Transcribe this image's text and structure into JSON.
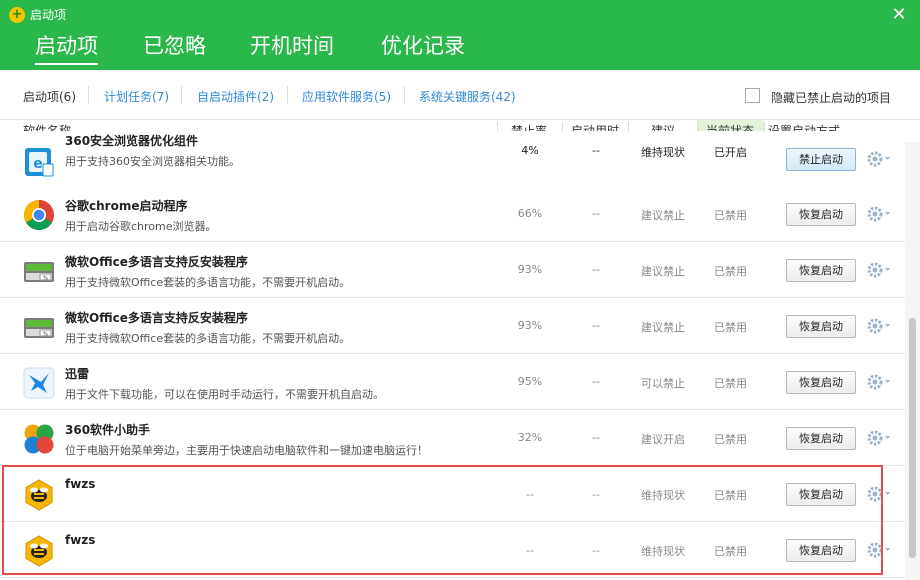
{
  "window": {
    "title": "启动项",
    "close_glyph": "✕",
    "logo_glyph": "+"
  },
  "main_tabs": [
    {
      "label": "启动项",
      "active": true
    },
    {
      "label": "已忽略"
    },
    {
      "label": "开机时间"
    },
    {
      "label": "优化记录"
    }
  ],
  "sub_tabs": [
    {
      "label": "启动项(6)",
      "active": true
    },
    {
      "label": "计划任务(7)"
    },
    {
      "label": "自启动插件(2)"
    },
    {
      "label": "应用软件服务(5)"
    },
    {
      "label": "系统关键服务(42)"
    }
  ],
  "hide_disabled": {
    "label": "隐藏已禁止启动的项目",
    "checked": false
  },
  "columns": {
    "name": "软件名称",
    "rate": "禁止率",
    "time": "启动用时",
    "suggestion": "建议",
    "status": "当前状态",
    "action": "设置启动方式"
  },
  "rows": [
    {
      "name": "360安全浏览器优化组件",
      "desc": "用于支持360安全浏览器相关功能。",
      "rate": "4%",
      "time": "--",
      "suggestion": "维持现状",
      "status": "已开启",
      "action": "禁止启动",
      "icon": "360-browser-icon"
    },
    {
      "name": "谷歌chrome启动程序",
      "desc": "用于启动谷歌chrome浏览器。",
      "rate": "66%",
      "time": "--",
      "suggestion": "建议禁止",
      "status": "已禁用",
      "action": "恢复启动",
      "icon": "chrome-icon"
    },
    {
      "name": "微软Office多语言支持反安装程序",
      "desc": "用于支持微软Office套装的多语言功能，不需要开机启动。",
      "rate": "93%",
      "time": "--",
      "suggestion": "建议禁止",
      "status": "已禁用",
      "action": "恢复启动",
      "icon": "office-installer-icon"
    },
    {
      "name": "微软Office多语言支持反安装程序",
      "desc": "用于支持微软Office套装的多语言功能，不需要开机启动。",
      "rate": "93%",
      "time": "--",
      "suggestion": "建议禁止",
      "status": "已禁用",
      "action": "恢复启动",
      "icon": "office-installer-icon"
    },
    {
      "name": "迅雷",
      "desc": "用于文件下载功能，可以在使用时手动运行，不需要开机自启动。",
      "rate": "95%",
      "time": "--",
      "suggestion": "可以禁止",
      "status": "已禁用",
      "action": "恢复启动",
      "icon": "thunder-icon"
    },
    {
      "name": "360软件小助手",
      "desc": "位于电脑开始菜单旁边，主要用于快速启动电脑软件和一键加速电脑运行！",
      "rate": "32%",
      "time": "--",
      "suggestion": "建议开启",
      "status": "已禁用",
      "action": "恢复启动",
      "icon": "360-assistant-icon"
    },
    {
      "name": "fwzs",
      "desc": "",
      "rate": "--",
      "time": "--",
      "suggestion": "维持现状",
      "status": "已禁用",
      "action": "恢复启动",
      "icon": "bee-icon"
    },
    {
      "name": "fwzs",
      "desc": "",
      "rate": "--",
      "time": "--",
      "suggestion": "维持现状",
      "status": "已禁用",
      "action": "恢复启动",
      "icon": "bee-icon"
    }
  ],
  "colors": {
    "header_green": "#2bb84a",
    "link_blue": "#2f8ad8",
    "status_column_bg": "#e3f3db",
    "highlight_red": "#e84d4d"
  }
}
